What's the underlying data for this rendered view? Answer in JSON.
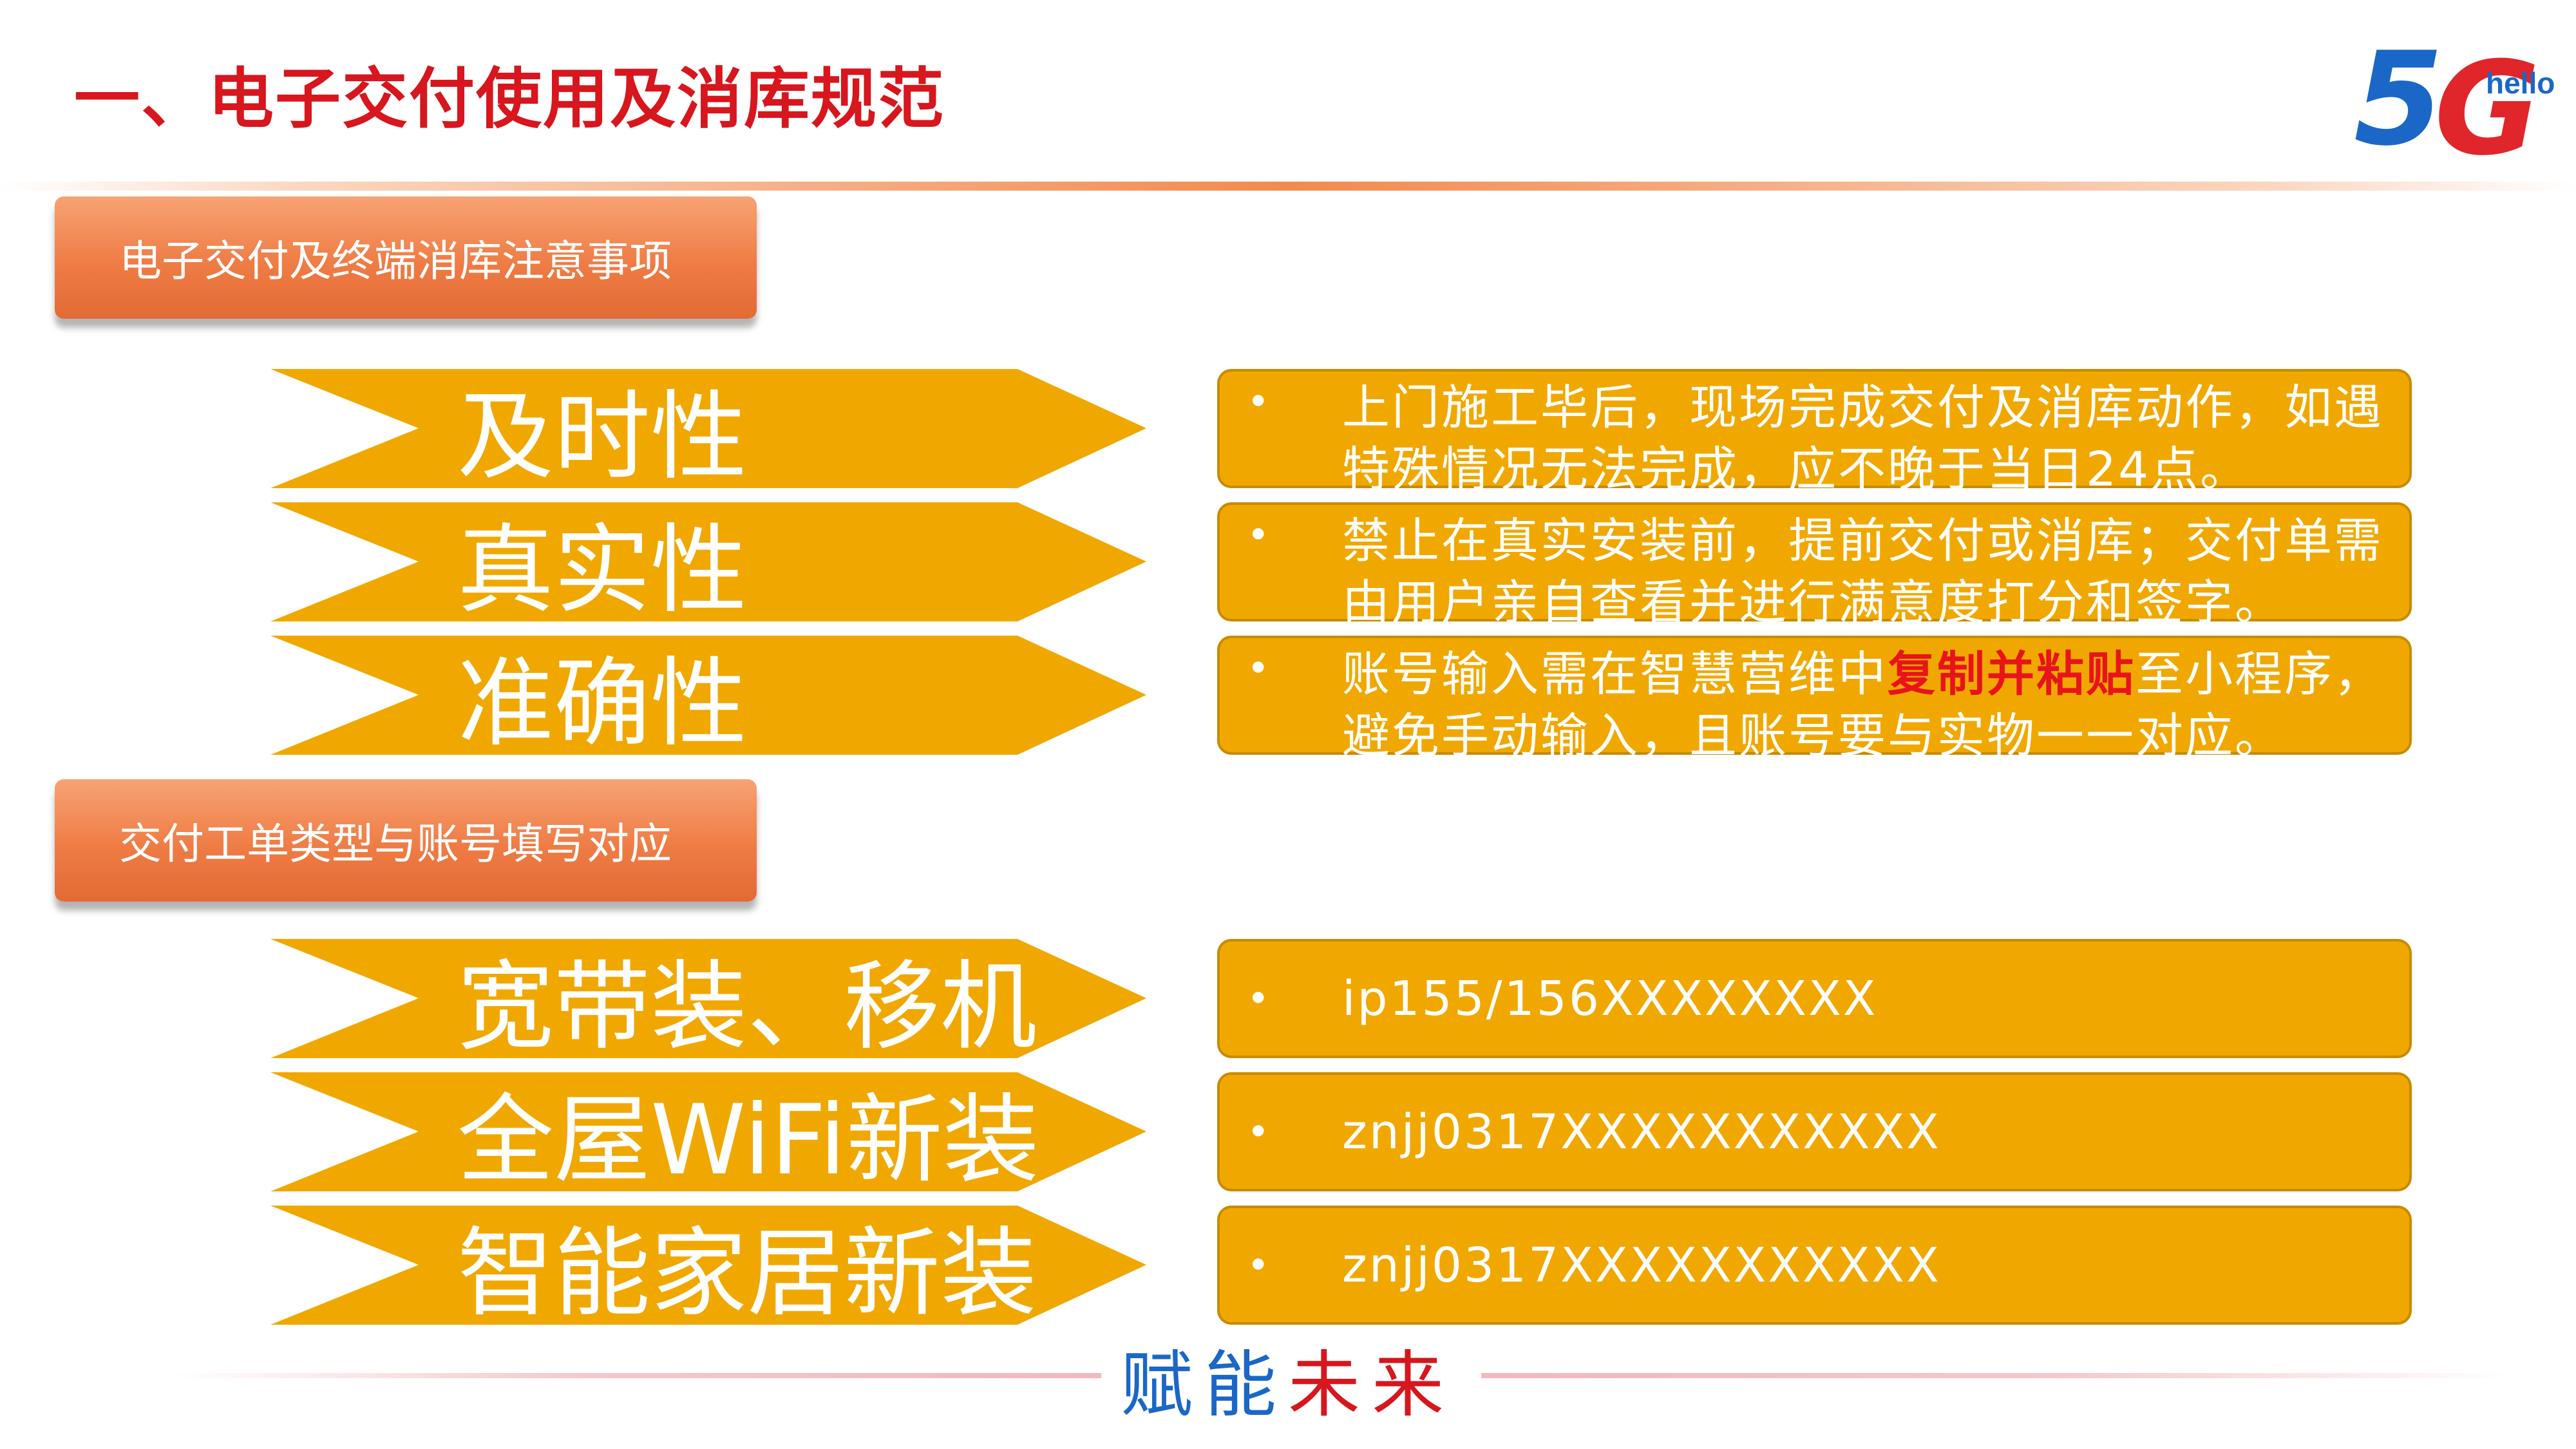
{
  "title": "一、电子交付使用及消库规范",
  "logo": {
    "main_5": "5",
    "main_g": "G",
    "tag": "hello"
  },
  "sections": [
    {
      "header": "电子交付及终端消库注意事项",
      "rows": [
        {
          "label": "及时性",
          "bullet": "•",
          "text": "上门施工毕后，现场完成交付及消库动作，如遇特殊情况无法完成，应不晚于当日24点。"
        },
        {
          "label": "真实性",
          "bullet": "•",
          "text": "禁止在真实安装前，提前交付或消库；交付单需由用户亲自查看并进行满意度打分和签字。"
        },
        {
          "label": "准确性",
          "bullet": "•",
          "text_pre": "账号输入需在智慧营维中",
          "text_highlight": "复制并粘贴",
          "text_post": "至小程序，避免手动输入，且账号要与实物一一对应。"
        }
      ]
    },
    {
      "header": "交付工单类型与账号填写对应",
      "rows": [
        {
          "label": "宽带装、移机",
          "bullet": "•",
          "text": "ip155/156XXXXXXXX"
        },
        {
          "label": "全屋WiFi新装",
          "bullet": "•",
          "text": "znjj0317XXXXXXXXXXX"
        },
        {
          "label": "智能家居新装",
          "bullet": "•",
          "text": "znjj0317XXXXXXXXXXX"
        }
      ]
    }
  ],
  "footer": {
    "slogan_blue": "赋能",
    "slogan_red": "未来"
  },
  "colors": {
    "title": "#d7161d",
    "arrow": "#f0a800",
    "header": "#ef7c45",
    "highlight": "#e8141a"
  }
}
